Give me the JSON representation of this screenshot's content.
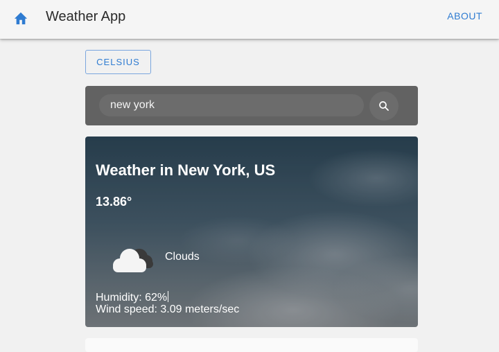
{
  "appbar": {
    "home_icon": "home-icon",
    "title": "Weather App",
    "about_label": "ABOUT"
  },
  "unit_toggle": {
    "label": "CELSIUS"
  },
  "search": {
    "value": "new york",
    "icon": "search-icon"
  },
  "weather": {
    "title": "Weather in New York, US",
    "temperature": "13.86°",
    "icon": "cloud-icon",
    "condition": "Clouds",
    "humidity": "Humidity: 62%",
    "wind": "Wind speed: 3.09 meters/sec"
  },
  "colors": {
    "accent": "#2e7bd1",
    "appbar_bg": "#f5f5f5",
    "search_card_bg": "#626262",
    "page_bg": "#f1f1f1"
  }
}
